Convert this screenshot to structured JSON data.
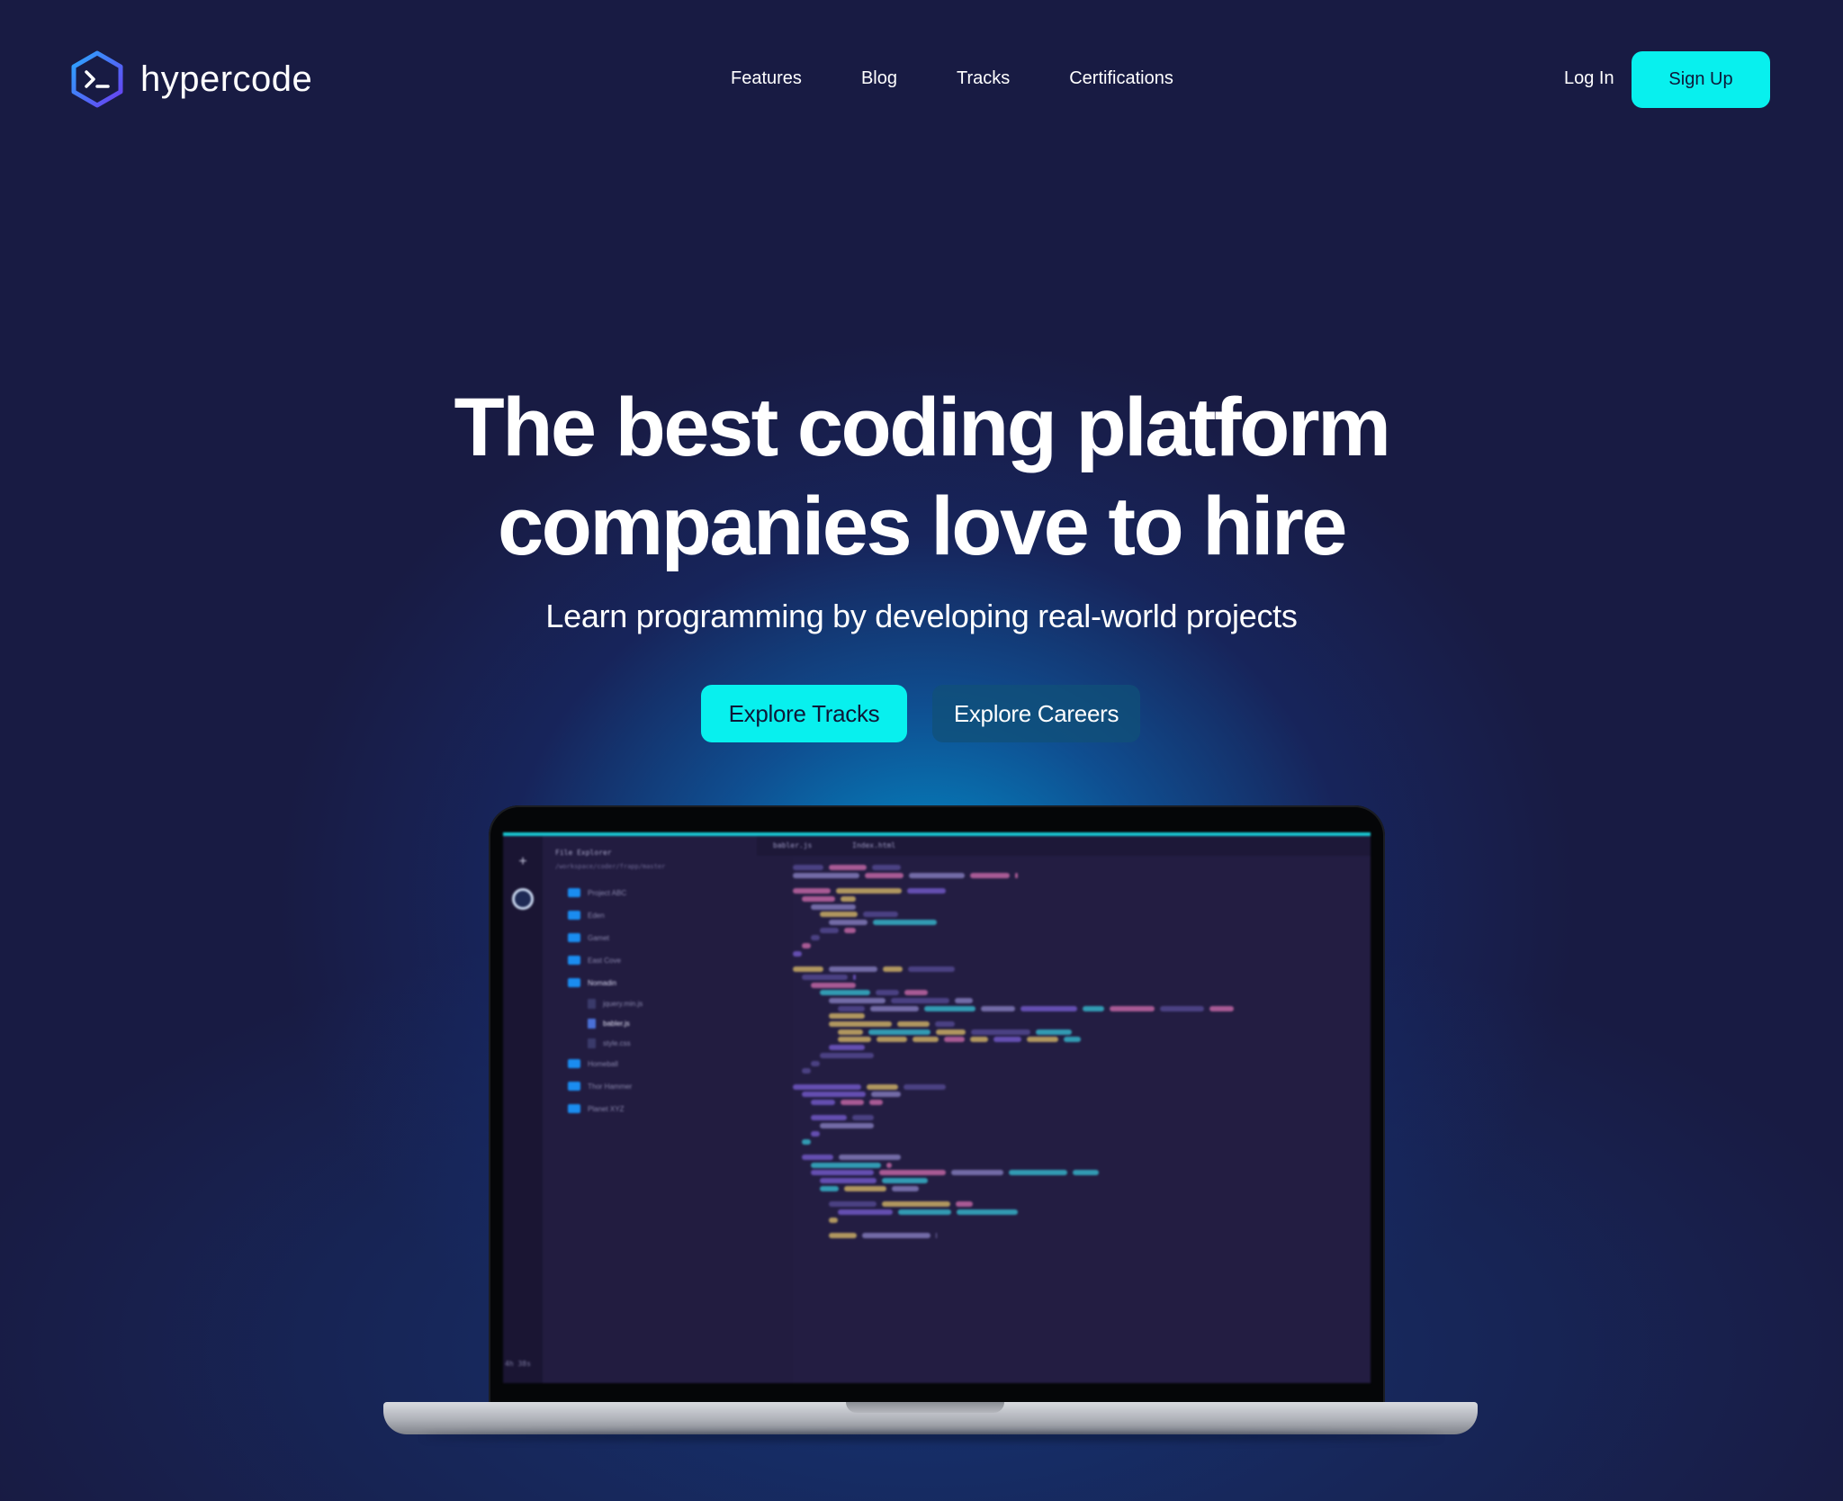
{
  "brand": {
    "name": "hypercode",
    "accent": "#08f0ee",
    "background": "#181b43"
  },
  "nav": {
    "links": [
      "Features",
      "Blog",
      "Tracks",
      "Certifications"
    ],
    "login_label": "Log In",
    "signup_label": "Sign Up"
  },
  "hero": {
    "title_line1": "The best coding platform",
    "title_line2": "companies love to hire",
    "subtitle": "Learn programming by developing real-world projects",
    "primary_cta": "Explore Tracks",
    "secondary_cta": "Explore Careers"
  },
  "ide": {
    "explorer_title": "File Explorer",
    "explorer_path": "/workspace/coder/frapp/master",
    "folders": [
      "Project ABC",
      "Eden",
      "Gamet",
      "East Cove",
      "Nomadin",
      "Homeball",
      "Thor Hammer",
      "Planet XYZ"
    ],
    "files": [
      "jquery.min.js",
      "babler.js",
      "style.css"
    ],
    "tabs": [
      "babler.js",
      "Index.html"
    ],
    "timer": "4h 38s"
  }
}
